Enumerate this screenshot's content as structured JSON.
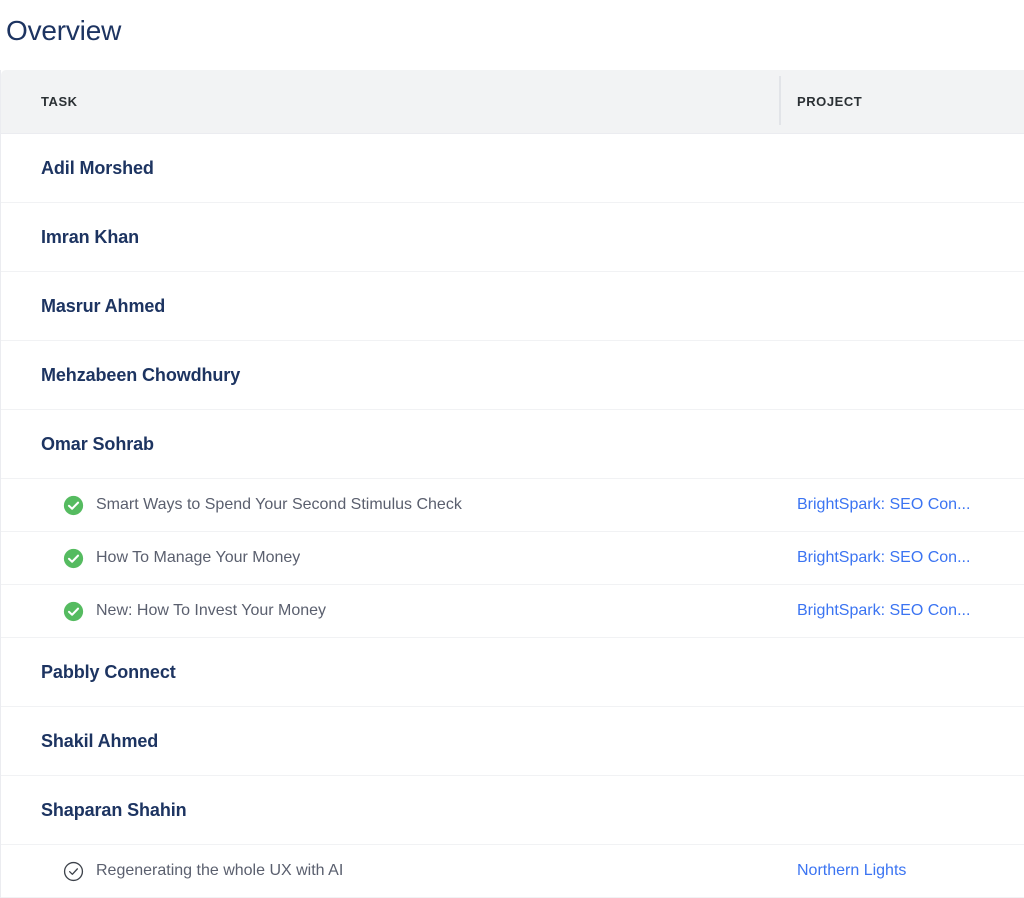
{
  "page": {
    "title": "Overview"
  },
  "table": {
    "columns": [
      {
        "key": "task",
        "label": "TASK"
      },
      {
        "key": "project",
        "label": "PROJECT"
      }
    ],
    "colors": {
      "header_background": "#f2f3f4",
      "header_text": "#2b3034",
      "group_name": "#1d3461",
      "task_text": "#5a5f6e",
      "link": "#3b74f2",
      "row_border": "#f1f2f4",
      "status_done_green": "#55bb60",
      "status_outline_dark": "#3d424a"
    },
    "rows": [
      {
        "type": "group",
        "name": "Adil Morshed"
      },
      {
        "type": "group",
        "name": "Imran Khan"
      },
      {
        "type": "group",
        "name": "Masrur Ahmed"
      },
      {
        "type": "group",
        "name": "Mehzabeen Chowdhury"
      },
      {
        "type": "group",
        "name": "Omar Sohrab"
      },
      {
        "type": "task",
        "status_icon": "check-circle-filled-icon",
        "name": "Smart Ways to Spend Your Second Stimulus Check",
        "project": "BrightSpark: SEO Con..."
      },
      {
        "type": "task",
        "status_icon": "check-circle-filled-icon",
        "name": "How To Manage Your Money",
        "project": "BrightSpark: SEO Con..."
      },
      {
        "type": "task",
        "status_icon": "check-circle-filled-icon",
        "name": "New: How To Invest Your Money",
        "project": "BrightSpark: SEO Con..."
      },
      {
        "type": "group",
        "name": "Pabbly Connect"
      },
      {
        "type": "group",
        "name": "Shakil Ahmed"
      },
      {
        "type": "group",
        "name": "Shaparan Shahin"
      },
      {
        "type": "task",
        "status_icon": "check-circle-outline-icon",
        "name": "Regenerating the whole UX with AI",
        "project": "Northern Lights"
      }
    ]
  }
}
